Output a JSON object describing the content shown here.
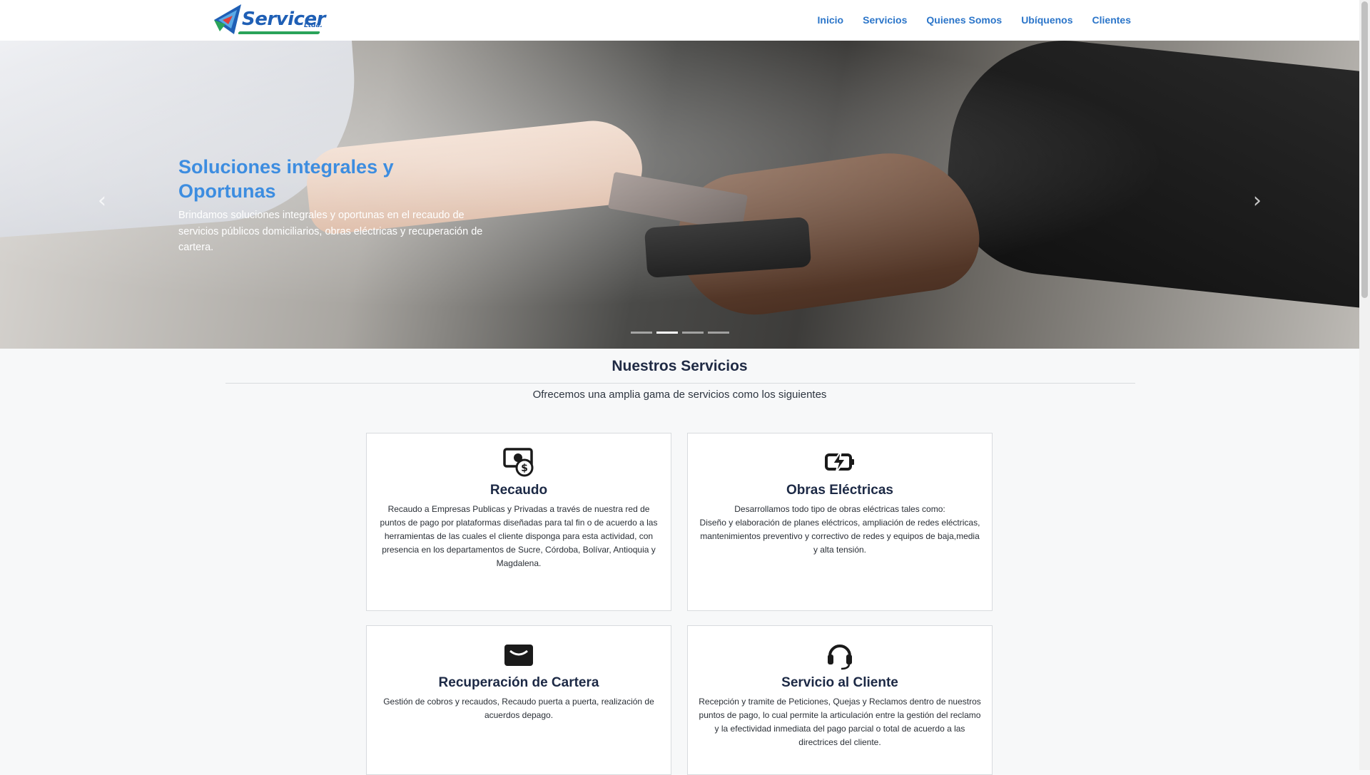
{
  "header": {
    "logo_text": "Servicer",
    "logo_sub": "Ltda.",
    "nav": [
      "Inicio",
      "Servicios",
      "Quienes Somos",
      "Ubíquenos",
      "Clientes"
    ]
  },
  "hero": {
    "title": "Soluciones integrales y Oportunas",
    "text": "Brindamos soluciones integrales y oportunas en el recaudo de servicios públicos domiciliarios, obras eléctricas y recuperación de cartera.",
    "prev_icon": "chevron-left-icon",
    "next_icon": "chevron-right-icon",
    "slides_total": 4,
    "active_slide": 2
  },
  "services": {
    "title": "Nuestros Servicios",
    "subtitle": "Ofrecemos una amplia gama de servicios como los siguientes",
    "cards": [
      {
        "icon": "cash-coin-icon",
        "title": "Recaudo",
        "text": "Recaudo a Empresas Publicas y Privadas a través de nuestra red de puntos de pago por plataformas diseñadas para tal fin o de acuerdo a las herramientas de las cuales el cliente disponga para esta actividad, con presencia en los departamentos de Sucre, Córdoba, Bolívar, Antioquia y Magdalena."
      },
      {
        "icon": "battery-charging-icon",
        "title": "Obras Eléctricas",
        "text": "Desarrollamos todo tipo de obras eléctricas tales como:",
        "text2": "Diseño y elaboración de planes eléctricos, ampliación de redes eléctricas, mantenimientos preventivo y correctivo de redes y equipos de baja,media y alta tensión."
      },
      {
        "icon": "wallet-icon",
        "title": "Recuperación de Cartera",
        "text": "Gestión de cobros y recaudos, Recaudo puerta a puerta, realización de acuerdos depago."
      },
      {
        "icon": "headset-icon",
        "title": "Servicio al Cliente",
        "text": "Recepción y tramite de Peticiones, Quejas y Reclamos dentro de nuestros puntos de pago, lo cual permite la articulación entre la gestión del reclamo y la efectividad inmediata del pago parcial o total de acuerdo a las directrices del cliente."
      }
    ]
  },
  "colors": {
    "accent": "#2b75c9",
    "hero_title": "#3d8de0",
    "heading": "#1c2945"
  }
}
